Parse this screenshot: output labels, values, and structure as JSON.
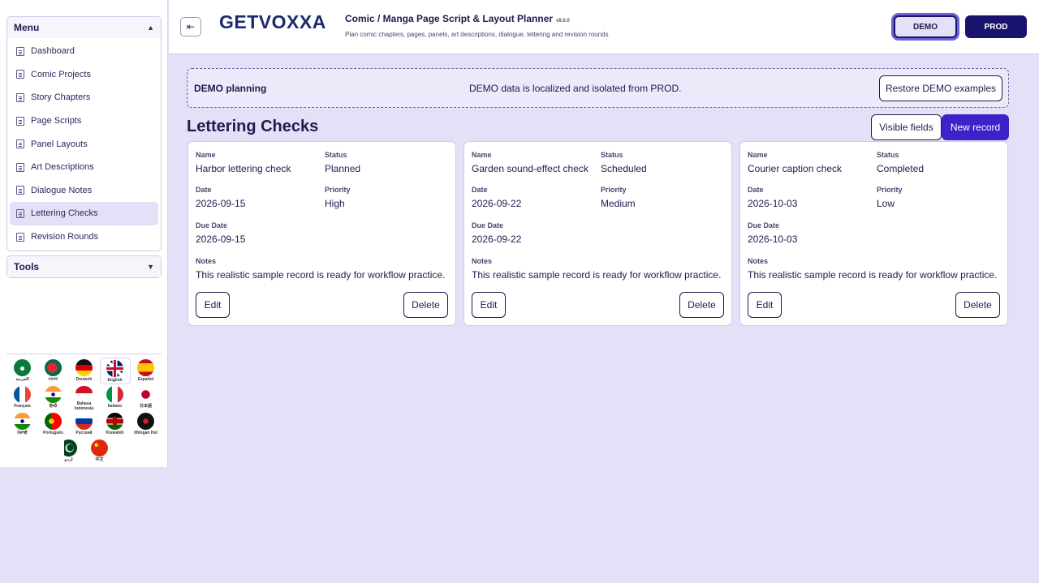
{
  "sidebar": {
    "menu_title": "Menu",
    "tools_title": "Tools",
    "items": [
      {
        "label": "Dashboard"
      },
      {
        "label": "Comic Projects"
      },
      {
        "label": "Story Chapters"
      },
      {
        "label": "Page Scripts"
      },
      {
        "label": "Panel Layouts"
      },
      {
        "label": "Art Descriptions"
      },
      {
        "label": "Dialogue Notes"
      },
      {
        "label": "Lettering Checks",
        "active": true
      },
      {
        "label": "Revision Rounds"
      }
    ],
    "languages": [
      {
        "label": "العربية",
        "flag": "sa"
      },
      {
        "label": "বাংলা",
        "flag": "bd"
      },
      {
        "label": "Deutsch",
        "flag": "de"
      },
      {
        "label": "English",
        "flag": "gb",
        "active": true
      },
      {
        "label": "Español",
        "flag": "es"
      },
      {
        "label": "Français",
        "flag": "fr"
      },
      {
        "label": "हिन्दी",
        "flag": "in"
      },
      {
        "label": "Bahasa Indonesia",
        "flag": "id"
      },
      {
        "label": "Italiano",
        "flag": "it"
      },
      {
        "label": "日本語",
        "flag": "jp"
      },
      {
        "label": "ਪੰਜਾਬੀ",
        "flag": "in2"
      },
      {
        "label": "Português",
        "flag": "pt"
      },
      {
        "label": "Русский",
        "flag": "ru"
      },
      {
        "label": "Kiswahili",
        "flag": "ke"
      },
      {
        "label": "tlhIngan Hol",
        "flag": "kl"
      },
      {
        "label": "اردو",
        "flag": "pk"
      },
      {
        "label": "中文",
        "flag": "cn"
      }
    ]
  },
  "header": {
    "logo_left": "GET",
    "logo_v": "V",
    "logo_right": "OXXA",
    "title": "Comic / Manga Page Script & Layout Planner",
    "version": "v9.0.0",
    "subtitle": "Plan comic chapters, pages, panels, art descriptions, dialogue, lettering and revision rounds",
    "env_demo": "DEMO",
    "env_prod": "PROD"
  },
  "banner": {
    "title": "DEMO planning",
    "message": "DEMO data is localized and isolated from PROD.",
    "restore_label": "Restore DEMO examples"
  },
  "section": {
    "title": "Lettering Checks",
    "visible_fields_label": "Visible fields",
    "new_record_label": "New record"
  },
  "labels": {
    "name": "Name",
    "status": "Status",
    "date": "Date",
    "priority": "Priority",
    "due_date": "Due Date",
    "notes": "Notes",
    "edit": "Edit",
    "delete": "Delete"
  },
  "records": [
    {
      "name": "Harbor lettering check",
      "status": "Planned",
      "date": "2026-09-15",
      "priority": "High",
      "due_date": "2026-09-15",
      "notes": "This realistic sample record is ready for workflow practice."
    },
    {
      "name": "Garden sound-effect check",
      "status": "Scheduled",
      "date": "2026-09-22",
      "priority": "Medium",
      "due_date": "2026-09-22",
      "notes": "This realistic sample record is ready for workflow practice."
    },
    {
      "name": "Courier caption check",
      "status": "Completed",
      "date": "2026-10-03",
      "priority": "Low",
      "due_date": "2026-10-03",
      "notes": "This realistic sample record is ready for workflow practice."
    }
  ]
}
